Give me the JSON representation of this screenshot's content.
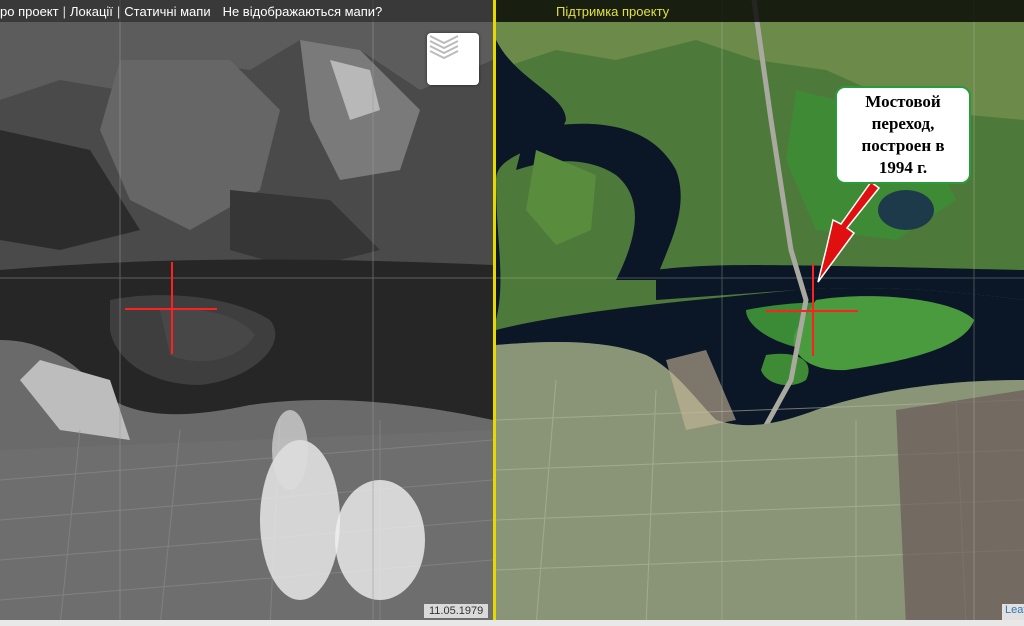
{
  "left_topbar": {
    "items": [
      "ро проект",
      "Локації",
      "Статичні мапи"
    ],
    "separator": "|",
    "help_link": "Не відображаються мапи?"
  },
  "right_topbar": {
    "support_link": "Підтримка проекту"
  },
  "left_map": {
    "date_label": "11.05.1979",
    "layers_icon": "layers-icon"
  },
  "right_map": {
    "callout_text": "Мостовой\nпереход,\nпостроен в\n1994 г.",
    "attribution": "Leaflet"
  },
  "colors": {
    "divider": "#e6d800",
    "crosshair": "#ff2020",
    "callout_border": "#2b9a3a",
    "arrow": "#e01010",
    "support_link": "#e0e040"
  }
}
